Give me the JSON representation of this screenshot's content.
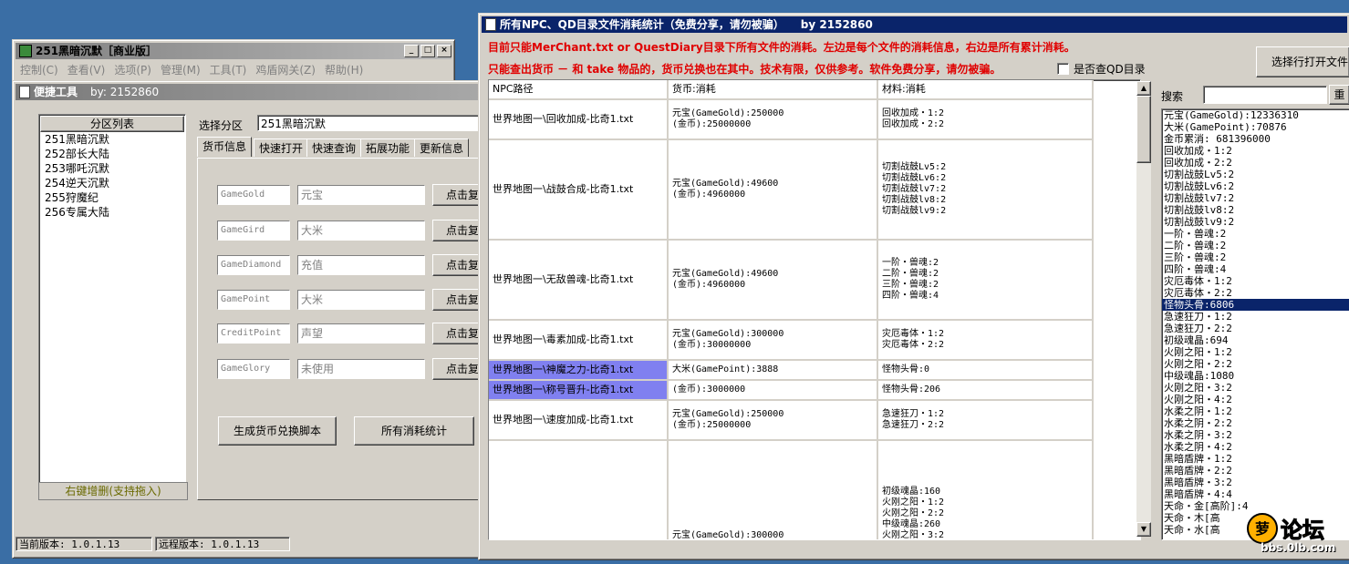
{
  "main_window": {
    "title": "251黑暗沉默［商业版］",
    "menu": [
      "控制(C)",
      "查看(V)",
      "选项(P)",
      "管理(M)",
      "工具(T)",
      "鸡盾网关(Z)",
      "帮助(H)"
    ]
  },
  "tool_window": {
    "title": "便捷工具",
    "by": "by: 2152860",
    "partition_header": "分区列表",
    "partitions": [
      "251黑暗沉默",
      "252部长大陆",
      "253哪吒沉默",
      "254逆天沉默",
      "255狩魔纪",
      "256专属大陆"
    ],
    "partition_footer": "右键增删(支持拖入)",
    "select_label": "选择分区",
    "select_value": "251黑暗沉默",
    "tabs": [
      "货币信息",
      "快速打开",
      "快速查询",
      "拓展功能",
      "更新信息"
    ],
    "currency_rows": [
      {
        "key": "GameGold",
        "value": "元宝",
        "button": "点击复"
      },
      {
        "key": "GameGird",
        "value": "大米",
        "button": "点击复"
      },
      {
        "key": "GameDiamond",
        "value": "充值",
        "button": "点击复"
      },
      {
        "key": "GamePoint",
        "value": "大米",
        "button": "点击复"
      },
      {
        "key": "CreditPoint",
        "value": "声望",
        "button": "点击复"
      },
      {
        "key": "GameGlory",
        "value": "未使用",
        "button": "点击复"
      }
    ],
    "gen_button": "生成货币兑换脚本",
    "stats_button": "所有消耗统计",
    "current_version": "当前版本: 1.0.1.13",
    "remote_version": "远程版本: 1.0.1.13"
  },
  "stats_window": {
    "title": "所有NPC、QD目录文件消耗统计（免费分享，请勿被骗）　　by 2152860",
    "notice1": "目前只能MerChant.txt or QuestDiary目录下所有文件的消耗。左边是每个文件的消耗信息，右边是所有累计消耗。",
    "notice2": "只能查出货币 － 和 take 物品的，货币兑换也在其中。技术有限，仅供参考。软件免费分享，请勿被骗。",
    "checkbox_label": "是否查QD目录",
    "open_button": "选择行打开文件",
    "search_label": "搜索",
    "search_button": "重",
    "columns": [
      "NPC路径",
      "货币:消耗",
      "材料:消耗"
    ],
    "rows": [
      {
        "path": "世界地图一\\回收加成-比奇1.txt",
        "currency": [
          "元宝(GameGold):250000",
          "(金币):25000000"
        ],
        "material": [
          "回收加成・1:2",
          "回收加成・2:2"
        ],
        "highlight": false
      },
      {
        "path": "世界地图一\\战鼓合成-比奇1.txt",
        "currency": [
          "元宝(GameGold):49600",
          "(金币):4960000"
        ],
        "material": [
          "切割战鼓Lv5:2",
          "切割战鼓Lv6:2",
          "切割战鼓lv7:2",
          "切割战鼓lv8:2",
          "切割战鼓lv9:2"
        ],
        "highlight": false
      },
      {
        "path": "世界地图一\\无敌兽魂-比奇1.txt",
        "currency": [
          "元宝(GameGold):49600",
          "(金币):4960000"
        ],
        "material": [
          "一阶・兽魂:2",
          "二阶・兽魂:2",
          "三阶・兽魂:2",
          "四阶・兽魂:4"
        ],
        "highlight": false
      },
      {
        "path": "世界地图一\\毒素加成-比奇1.txt",
        "currency": [
          "元宝(GameGold):300000",
          "(金币):30000000"
        ],
        "material": [
          "灾厄毒体・1:2",
          "灾厄毒体・2:2"
        ],
        "highlight": false
      },
      {
        "path": "世界地图一\\神魔之力-比奇1.txt",
        "currency": [
          "大米(GamePoint):3888"
        ],
        "material": [
          "怪物头骨:0"
        ],
        "highlight": true
      },
      {
        "path": "世界地图一\\称号晋升-比奇1.txt",
        "currency": [
          "(金币):3000000"
        ],
        "material": [
          "怪物头骨:206"
        ],
        "highlight": true
      },
      {
        "path": "世界地图一\\速度加成-比奇1.txt",
        "currency": [
          "元宝(GameGold):250000",
          "(金币):25000000"
        ],
        "material": [
          "急速狂刀・1:2",
          "急速狂刀・2:2"
        ],
        "highlight": false
      },
      {
        "path": "",
        "currency": [
          "元宝(GameGold):300000"
        ],
        "material": [
          "初级魂晶:160",
          "火刚之阳・1:2",
          "火刚之阳・2:2",
          "中级魂晶:260",
          "火刚之阳・3:2"
        ],
        "highlight": false
      }
    ],
    "totals": [
      "元宝(GameGold):12336310",
      "大米(GamePoint):70876",
      "金币累消: 681396000",
      "回收加成・1:2",
      "回收加成・2:2",
      "切割战鼓Lv5:2",
      "切割战鼓Lv6:2",
      "切割战鼓lv7:2",
      "切割战鼓lv8:2",
      "切割战鼓lv9:2",
      "一阶・兽魂:2",
      "二阶・兽魂:2",
      "三阶・兽魂:2",
      "四阶・兽魂:4",
      "灾厄毒体・1:2",
      "灾厄毒体・2:2",
      "怪物头骨:6806",
      "急速狂刀・1:2",
      "急速狂刀・2:2",
      "初级魂晶:694",
      "火刚之阳・1:2",
      "火刚之阳・2:2",
      "中级魂晶:1080",
      "火刚之阳・3:2",
      "火刚之阳・4:2",
      "水柔之阴・1:2",
      "水柔之阴・2:2",
      "水柔之阴・3:2",
      "水柔之阴・4:2",
      "黑暗盾牌・1:2",
      "黑暗盾牌・2:2",
      "黑暗盾牌・3:2",
      "黑暗盾牌・4:4",
      "天命・金[高阶]:4",
      "天命・木[高",
      "天命・水[高"
    ],
    "totals_selected_index": 16
  },
  "watermark": {
    "brand": "论坛",
    "site": "bbs.0lb.com"
  },
  "colors": {
    "desktop": "#3a6ea5",
    "title_active": "#0a246a",
    "notice": "#e00000",
    "row_highlight": "#8080f0"
  }
}
